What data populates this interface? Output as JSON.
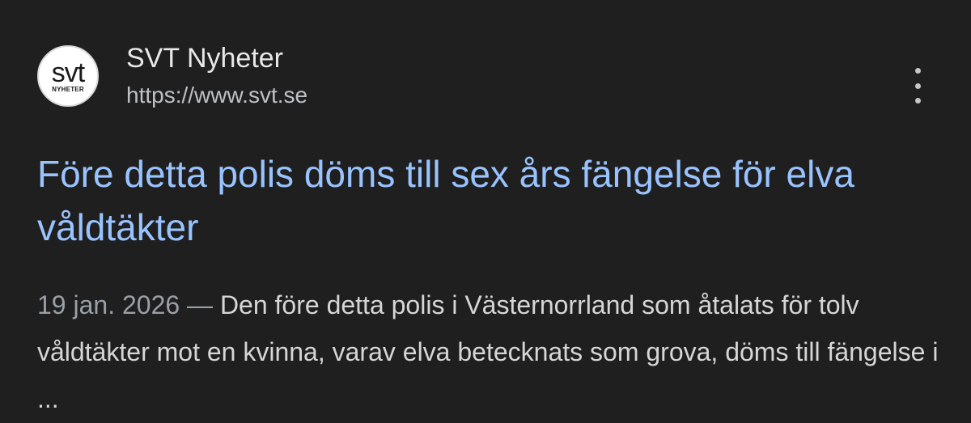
{
  "result": {
    "favicon": {
      "main_text": "svt",
      "sub_text": "NYHETER"
    },
    "site_name": "SVT Nyheter",
    "url": "https://www.svt.se",
    "more_icon": "more-vert-icon",
    "headline": "Före detta polis döms till sex års fängelse för elva våldtäkter",
    "date": "19 jan. 2026",
    "separator": "—",
    "snippet": "Den före detta polis i Västernorrland som åtalats för tolv våldtäkter mot en kvinna, varav elva betecknats som grova, döms till fängelse i ..."
  },
  "colors": {
    "background": "#1f1f1f",
    "headline": "#99c3ff",
    "site_name": "#e8e8e8",
    "url": "#bdc1c6",
    "date": "#9aa0a6",
    "snippet": "#d6d6d6"
  }
}
